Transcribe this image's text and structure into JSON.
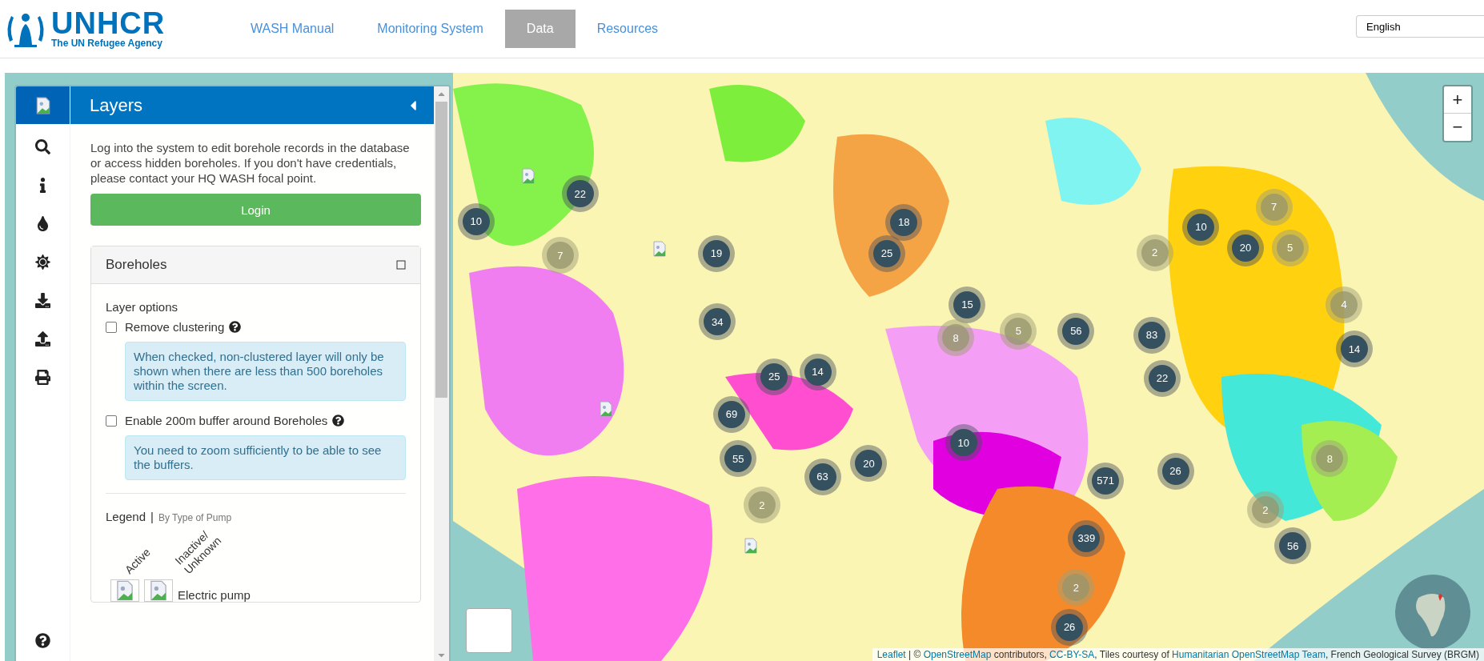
{
  "header": {
    "logo": {
      "name": "UNHCR",
      "tagline": "The UN Refugee Agency"
    },
    "nav": [
      {
        "label": "WASH Manual",
        "selected": false
      },
      {
        "label": "Monitoring System",
        "selected": false
      },
      {
        "label": "Data",
        "selected": true
      },
      {
        "label": "Resources",
        "selected": false
      }
    ],
    "language": "English"
  },
  "panel": {
    "title": "Layers",
    "login_message": "Log into the system to edit borehole records in the database or access hidden boreholes. If you don't have credentials, please contact your HQ WASH focal point.",
    "login_button": "Login",
    "boreholes": {
      "title": "Boreholes",
      "section_title": "Layer options",
      "options": [
        {
          "label": "Remove clustering",
          "checked": false,
          "note": "When checked, non-clustered layer will only be shown when there are less than 500 boreholes within the screen."
        },
        {
          "label": "Enable 200m buffer around Boreholes",
          "checked": false,
          "note": "You need to zoom sufficiently to be able to see the buffers."
        }
      ],
      "legend": {
        "title": "Legend",
        "separator": "|",
        "subtitle": "By Type of Pump",
        "columns": [
          "Active",
          "Inactive/ Unknown"
        ],
        "rows": [
          {
            "label": "Electric pump"
          }
        ]
      }
    }
  },
  "map": {
    "zoom_in": "+",
    "zoom_out": "−",
    "clusters": [
      {
        "count": "22",
        "faded": false
      },
      {
        "count": "10",
        "faded": false
      },
      {
        "count": "7",
        "faded": true
      },
      {
        "count": "19",
        "faded": false
      },
      {
        "count": "18",
        "faded": false
      },
      {
        "count": "25",
        "faded": false
      },
      {
        "count": "15",
        "faded": false
      },
      {
        "count": "8",
        "faded": true
      },
      {
        "count": "5",
        "faded": true
      },
      {
        "count": "56",
        "faded": false
      },
      {
        "count": "34",
        "faded": false
      },
      {
        "count": "25",
        "faded": false
      },
      {
        "count": "14",
        "faded": false
      },
      {
        "count": "69",
        "faded": false
      },
      {
        "count": "55",
        "faded": false
      },
      {
        "count": "63",
        "faded": false
      },
      {
        "count": "20",
        "faded": false
      },
      {
        "count": "10",
        "faded": false
      },
      {
        "count": "2",
        "faded": true
      },
      {
        "count": "571",
        "faded": false
      },
      {
        "count": "339",
        "faded": false
      },
      {
        "count": "2",
        "faded": true
      },
      {
        "count": "26",
        "faded": false
      },
      {
        "count": "2",
        "faded": true
      },
      {
        "count": "10",
        "faded": false
      },
      {
        "count": "20",
        "faded": false
      },
      {
        "count": "7",
        "faded": true
      },
      {
        "count": "5",
        "faded": true
      },
      {
        "count": "83",
        "faded": false
      },
      {
        "count": "22",
        "faded": false
      },
      {
        "count": "4",
        "faded": true
      },
      {
        "count": "14",
        "faded": false
      },
      {
        "count": "26",
        "faded": false
      },
      {
        "count": "8",
        "faded": true
      },
      {
        "count": "2",
        "faded": true
      },
      {
        "count": "56",
        "faded": false
      }
    ],
    "attribution": [
      {
        "text": "Leaflet",
        "link": true
      },
      {
        "text": " | © ",
        "link": false
      },
      {
        "text": "OpenStreetMap",
        "link": true
      },
      {
        "text": " contributors, ",
        "link": false
      },
      {
        "text": "CC-BY-SA",
        "link": true
      },
      {
        "text": ", Tiles courtesy of ",
        "link": false
      },
      {
        "text": "Humanitarian OpenStreetMap Team",
        "link": true
      },
      {
        "text": ", French Geological Survey (BRGM)",
        "link": false
      }
    ]
  }
}
